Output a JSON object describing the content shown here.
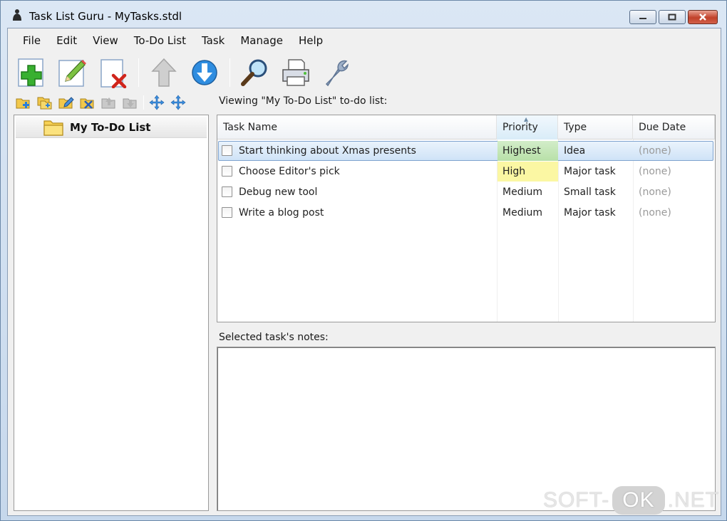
{
  "window": {
    "title": "Task List Guru - MyTasks.stdl",
    "buttons": [
      "minimize-icon",
      "restore-icon",
      "close-icon"
    ]
  },
  "menu": {
    "items": [
      "File",
      "Edit",
      "View",
      "To-Do List",
      "Task",
      "Manage",
      "Help"
    ]
  },
  "toolbar": {
    "icons": [
      "add-task-icon",
      "edit-task-icon",
      "delete-task-icon",
      "move-up-icon",
      "move-down-icon",
      "search-icon",
      "print-icon",
      "settings-wrench-icon"
    ]
  },
  "list_toolbar": {
    "icons": [
      "new-list-icon",
      "new-sublist-icon",
      "edit-list-icon",
      "delete-list-icon",
      "move-list-up-icon",
      "move-list-down-icon",
      "move-list-icon",
      "move-list-alt-icon"
    ]
  },
  "tree": {
    "items": [
      {
        "label": "My To-Do List",
        "icon": "folder-icon"
      }
    ]
  },
  "main": {
    "viewing_label": "Viewing \"My To-Do List\" to-do list:",
    "notes_label": "Selected task's notes:",
    "notes_value": ""
  },
  "grid": {
    "columns": [
      "Task Name",
      "Priority",
      "Type",
      "Due Date"
    ],
    "sorted_column": "Priority",
    "rows": [
      {
        "name": "Start thinking about Xmas presents",
        "priority": "Highest",
        "type": "Idea",
        "due": "(none)",
        "checked": false,
        "selected": true
      },
      {
        "name": "Choose Editor's pick",
        "priority": "High",
        "type": "Major task",
        "due": "(none)",
        "checked": false,
        "selected": false
      },
      {
        "name": "Debug new tool",
        "priority": "Medium",
        "type": "Small task",
        "due": "(none)",
        "checked": false,
        "selected": false
      },
      {
        "name": "Write a blog post",
        "priority": "Medium",
        "type": "Major task",
        "due": "(none)",
        "checked": false,
        "selected": false
      }
    ]
  },
  "watermark": {
    "left": "SOFT-",
    "middle": "OK",
    "right": ".NET"
  },
  "colors": {
    "selection": "#cfe3f7",
    "priority_highest": "#b8e0a8",
    "priority_high": "#fbf7a3"
  }
}
